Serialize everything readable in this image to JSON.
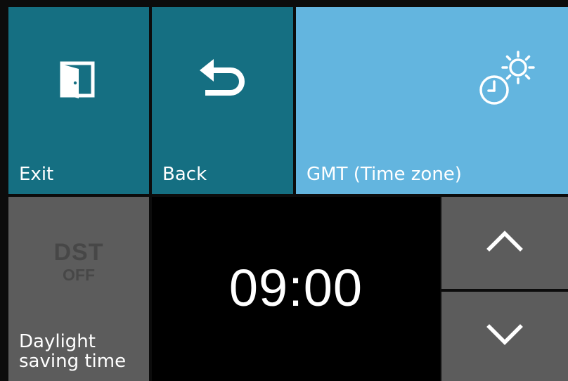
{
  "tiles": {
    "exit": {
      "label": "Exit",
      "icon": "exit-door-icon"
    },
    "back": {
      "label": "Back",
      "icon": "undo-arrow-icon"
    },
    "gmt": {
      "label": "GMT (Time zone)",
      "icon": "clock-sun-icon"
    },
    "dst": {
      "badge_top": "DST",
      "badge_bottom": "OFF",
      "label_line1": "Daylight",
      "label_line2": "saving time"
    }
  },
  "time_display": {
    "value": "09:00"
  },
  "controls": {
    "up": {
      "icon": "chevron-up-icon"
    },
    "down": {
      "icon": "chevron-down-icon"
    }
  },
  "colors": {
    "dark_teal": "#156f82",
    "light_blue": "#63b5df",
    "gray": "#5c5c5c",
    "display_bg": "#000000",
    "badge_text": "#474747"
  }
}
